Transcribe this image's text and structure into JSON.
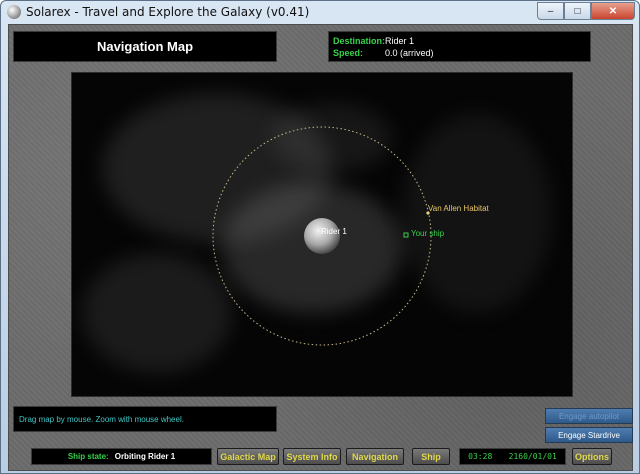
{
  "window": {
    "title": "Solarex - Travel and Explore the Galaxy (v0.41)",
    "minimize_glyph": "–",
    "maximize_glyph": "□",
    "close_glyph": "✕"
  },
  "header": {
    "title": "Navigation Map",
    "destination_label": "Destination:",
    "destination_value": "Rider 1",
    "speed_label": "Speed:",
    "speed_value": "0.0 (arrived)"
  },
  "map": {
    "planet_label": "Rider 1",
    "habitat_label": "Van Allen Habitat",
    "ship_label": "Your ship",
    "hint": "Drag map by mouse. Zoom with mouse wheel."
  },
  "side_buttons": {
    "autopilot": "Engage autopilot",
    "stardrive": "Engage Stardrive"
  },
  "status": {
    "ship_state_label": "Ship state:",
    "ship_state_value": "Orbiting Rider 1",
    "time": "03:28",
    "date": "2160/01/01"
  },
  "toolbar": {
    "galactic_map": "Galactic Map",
    "system_info": "System Info",
    "navigation": "Navigation",
    "ship": "Ship",
    "options": "Options"
  },
  "colors": {
    "accent_green": "#39d24a",
    "button_text": "#e0d84a",
    "hint_text": "#3ec7c7",
    "habitat_label": "#e8c56a",
    "orbit": "#c8b98a"
  }
}
